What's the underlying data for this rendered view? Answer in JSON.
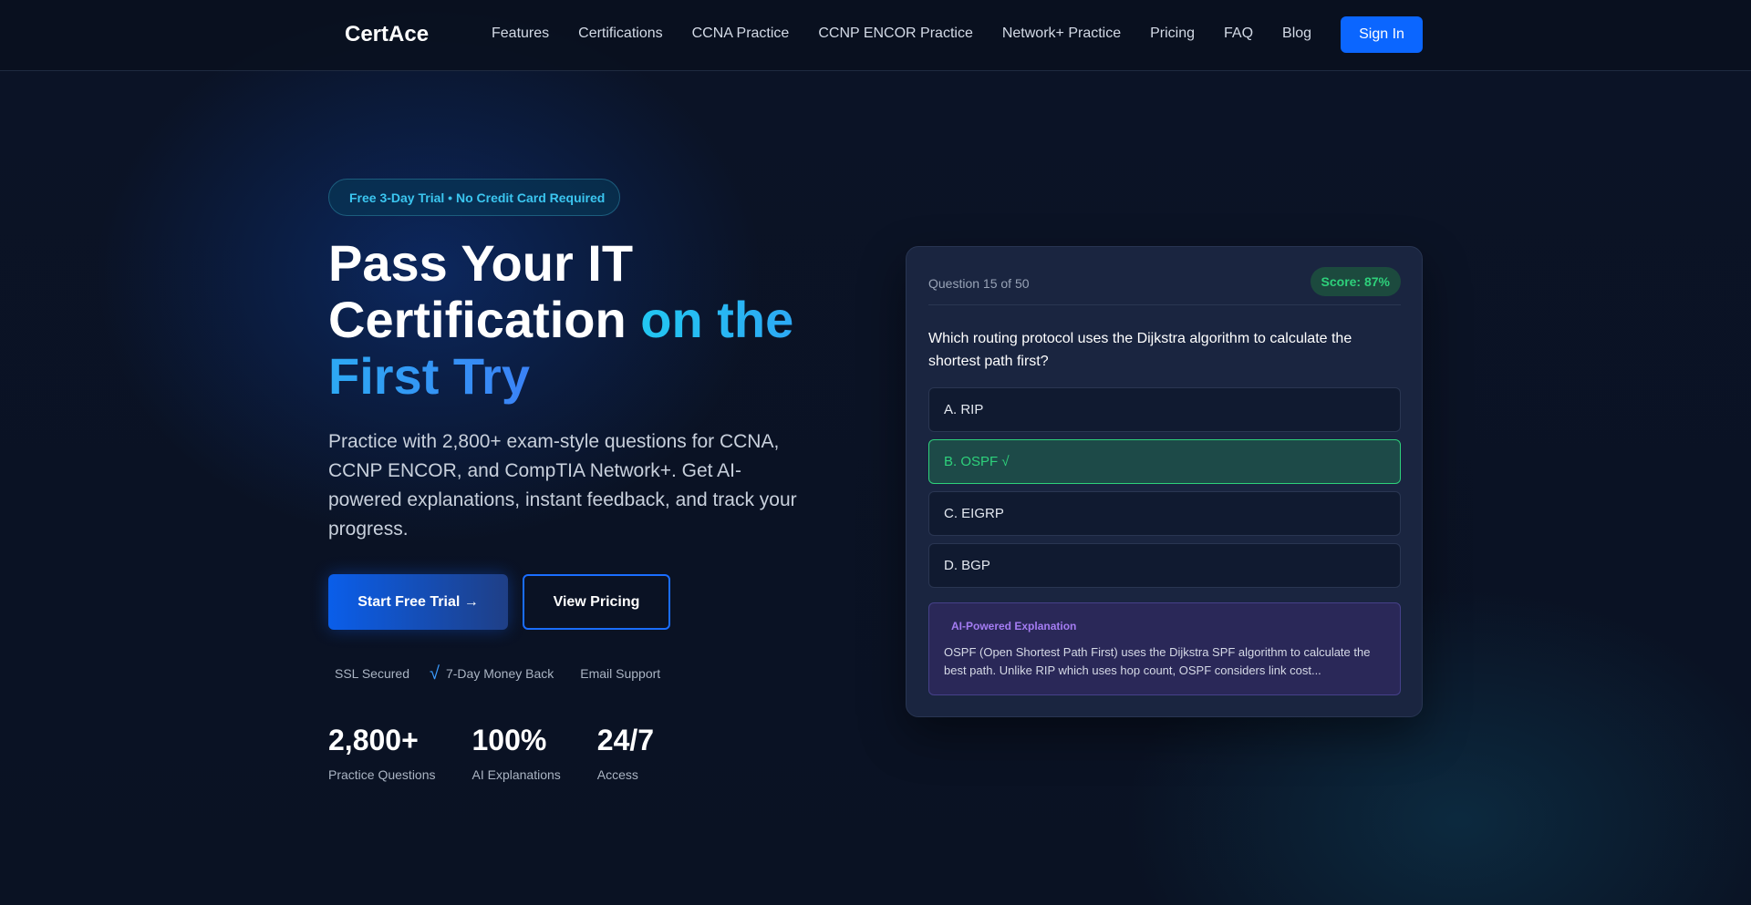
{
  "nav": {
    "logo": {
      "icon": "shield-icon",
      "glyph": "",
      "text": "CertAce"
    },
    "links": [
      "Features",
      "Certifications",
      "CCNA Practice",
      "CCNP ENCOR Practice",
      "Network+ Practice",
      "Pricing",
      "FAQ",
      "Blog"
    ],
    "signin_label": "Sign In"
  },
  "hero": {
    "badge": {
      "icon": "gift-icon",
      "glyph": "",
      "text": "Free 3-Day Trial • No Credit Card Required"
    },
    "headline_plain": "Pass Your IT Certification ",
    "headline_accent": "on the First Try",
    "subtext": "Practice with 2,800+ exam-style questions for CCNA, CCNP ENCOR, and CompTIA Network+. Get AI-powered explanations, instant feedback, and track your progress.",
    "cta_primary": "Start Free Trial →",
    "cta_secondary": "View Pricing",
    "trust": [
      {
        "icon": "lock-icon",
        "glyph": "",
        "text": "SSL Secured"
      },
      {
        "icon": "check-icon",
        "glyph": "√",
        "text": "7-Day Money Back"
      },
      {
        "icon": "mail-icon",
        "glyph": "",
        "text": "Email Support"
      }
    ],
    "stats": [
      {
        "value": "2,800+",
        "label": "Practice Questions"
      },
      {
        "value": "100%",
        "label": "AI Explanations"
      },
      {
        "value": "24/7",
        "label": "Access"
      }
    ]
  },
  "quiz": {
    "counter": "Question 15 of 50",
    "score": "Score: 87%",
    "question": "Which routing protocol uses the Dijkstra algorithm to calculate the shortest path first?",
    "options": [
      {
        "label": "A. RIP",
        "correct": false
      },
      {
        "label": "B. OSPF √",
        "correct": true
      },
      {
        "label": "C. EIGRP",
        "correct": false
      },
      {
        "label": "D. BGP",
        "correct": false
      }
    ],
    "explanation": {
      "icon": "robot-icon",
      "glyph": "",
      "title": "AI-Powered Explanation",
      "text": "OSPF (Open Shortest Path First) uses the Dijkstra SPF algorithm to calculate the best path. Unlike RIP which uses hop count, OSPF considers link cost..."
    }
  },
  "colors": {
    "brand_blue": "#0b66ff",
    "accent_cyan": "#22c7f2",
    "success_green": "#2ed17b",
    "ai_purple": "#a47cf2"
  }
}
